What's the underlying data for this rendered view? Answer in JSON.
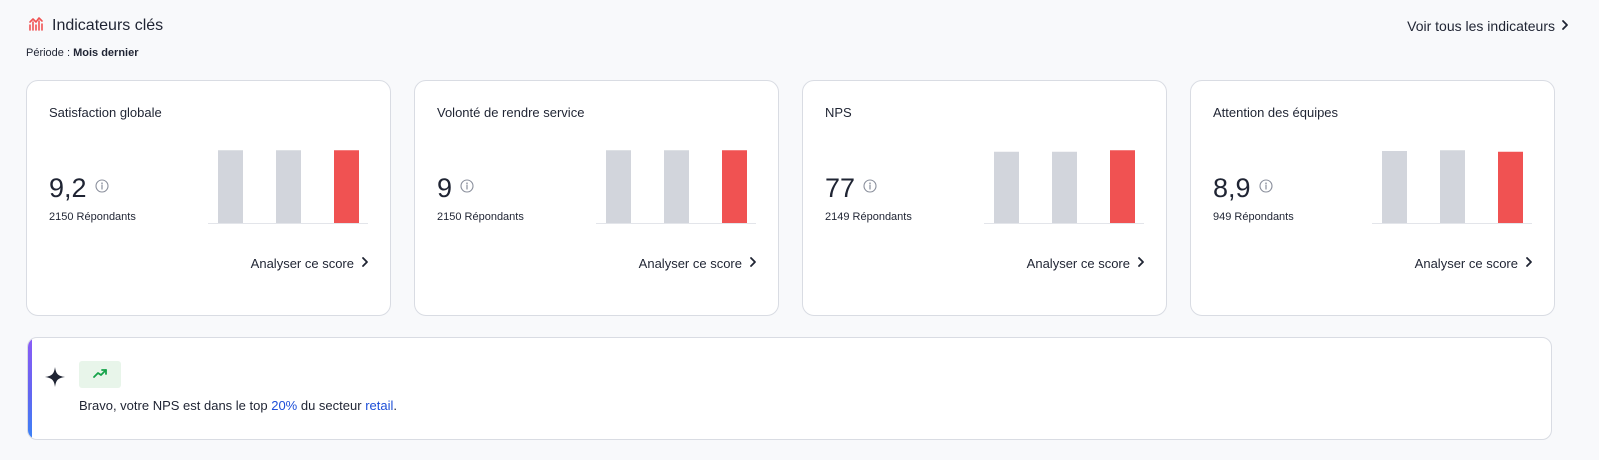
{
  "header": {
    "title": "Indicateurs clés",
    "see_all_label": "Voir tous les indicateurs",
    "icon": "line-chart-icon"
  },
  "period": {
    "label": "Période :",
    "value": "Mois dernier"
  },
  "colors": {
    "accent_red": "#f05252",
    "bar_gray": "#d2d5dc",
    "link_blue": "#1d4fd8",
    "trend_green": "#16a34a",
    "trend_bg": "#e8f5ea"
  },
  "cards": [
    {
      "title": "Satisfaction globale",
      "score": "9,2",
      "respondents": "2150 Répondants",
      "analyze_label": "Analyser ce score",
      "bar_levels": [
        0.97,
        0.97,
        0.97
      ]
    },
    {
      "title": "Volonté de rendre service",
      "score": "9",
      "respondents": "2150 Répondants",
      "analyze_label": "Analyser ce score",
      "bar_levels": [
        0.97,
        0.97,
        0.97
      ]
    },
    {
      "title": "NPS",
      "score": "77",
      "respondents": "2149 Répondants",
      "analyze_label": "Analyser ce score",
      "bar_levels": [
        0.95,
        0.95,
        0.97
      ]
    },
    {
      "title": "Attention des équipes",
      "score": "8,9",
      "respondents": "949 Répondants",
      "analyze_label": "Analyser ce score",
      "bar_levels": [
        0.96,
        0.97,
        0.95
      ]
    }
  ],
  "insight": {
    "prefix": "Bravo, votre NPS est dans le top ",
    "percent": "20%",
    "middle": " du secteur ",
    "sector": "retail",
    "suffix": "."
  }
}
